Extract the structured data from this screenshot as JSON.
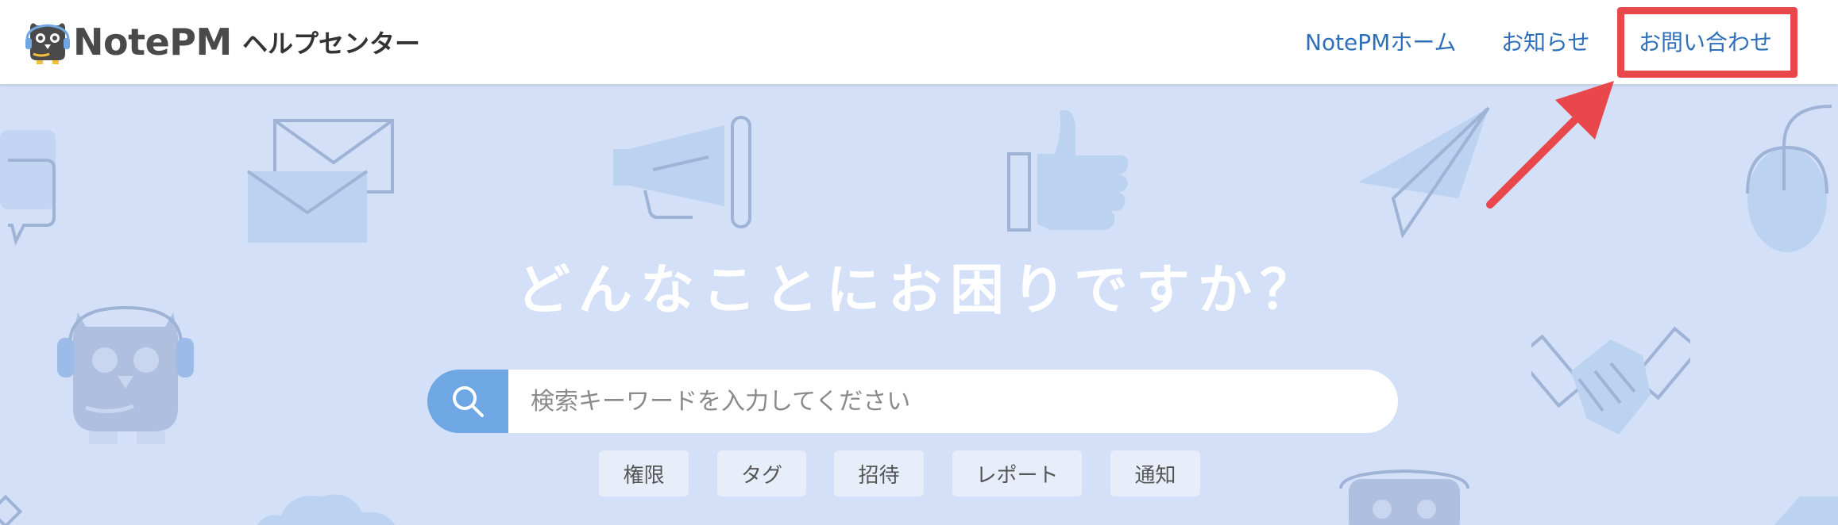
{
  "header": {
    "logo_text": "NotePM",
    "section_title": "ヘルプセンター",
    "nav": [
      {
        "label": "NotePMホーム"
      },
      {
        "label": "お知らせ"
      },
      {
        "label": "お問い合わせ"
      }
    ]
  },
  "hero": {
    "title": "どんなことにお困りですか？",
    "search": {
      "placeholder": "検索キーワードを入力してください",
      "value": ""
    },
    "tags": [
      "権限",
      "タグ",
      "招待",
      "レポート",
      "通知"
    ]
  },
  "annotation": {
    "color": "#e8474c",
    "target": "お問い合わせ"
  },
  "colors": {
    "link": "#2f6fba",
    "hero_bg": "#d3e0f7",
    "search_button": "#6fa7e4"
  },
  "icons": [
    "search-icon",
    "chat-bubble-icon",
    "envelope-icon",
    "megaphone-icon",
    "thumbs-up-icon",
    "paper-plane-icon",
    "mouse-icon",
    "owl-mascot-icon",
    "handshake-icon",
    "cloud-icon"
  ]
}
